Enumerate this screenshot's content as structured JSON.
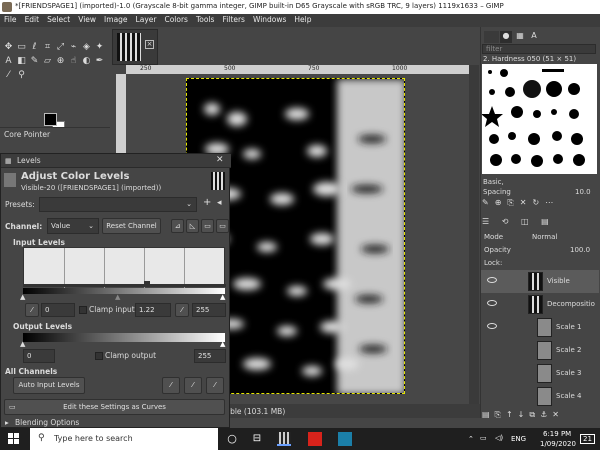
{
  "window": {
    "title": "*[FRIENDSPAGE1] (imported)-1.0 (Grayscale 8-bit gamma integer, GIMP built-in D65 Grayscale with sRGB TRC, 9 layers) 1119x1633 – GIMP"
  },
  "menu": [
    "File",
    "Edit",
    "Select",
    "View",
    "Image",
    "Layer",
    "Colors",
    "Tools",
    "Filters",
    "Windows",
    "Help"
  ],
  "toolbox": {
    "panel_title": "Core Pointer"
  },
  "ruler": {
    "ticks": [
      "250",
      "500",
      "750",
      "1000"
    ]
  },
  "status": {
    "text": "ible (103.1 MB)"
  },
  "brushes": {
    "filter_placeholder": "filter",
    "brush_name": "2. Hardness 050 (51 × 51)",
    "category": "Basic,",
    "spacing_label": "Spacing",
    "spacing_value": "10.0"
  },
  "layers": {
    "mode_label": "Mode",
    "mode_value": "Normal",
    "opacity_label": "Opacity",
    "opacity_value": "100.0",
    "lock_label": "Lock:",
    "items": [
      {
        "name": "Visible"
      },
      {
        "name": "Decompositio"
      },
      {
        "name": "Scale 1"
      },
      {
        "name": "Scale 2"
      },
      {
        "name": "Scale 3"
      },
      {
        "name": "Scale 4"
      }
    ]
  },
  "levels": {
    "window_title": "Levels",
    "heading": "Adjust Color Levels",
    "subheading": "Visible-20 ([FRIENDSPAGE1] (imported))",
    "presets_label": "Presets:",
    "channel_label": "Channel:",
    "channel_value": "Value",
    "reset_channel": "Reset Channel",
    "input_levels": "Input Levels",
    "input_low": "0",
    "clamp_input": "Clamp input",
    "gamma": "1.22",
    "input_high": "255",
    "output_levels": "Output Levels",
    "output_low": "0",
    "clamp_output": "Clamp output",
    "output_high": "255",
    "all_channels": "All Channels",
    "auto_input": "Auto Input Levels",
    "edit_curves": "Edit these Settings as Curves",
    "blending_options": "Blending Options"
  },
  "taskbar": {
    "search_placeholder": "Type here to search",
    "lang": "ENG",
    "time": "6:19 PM",
    "date": "1/09/2020",
    "notif": "21"
  }
}
